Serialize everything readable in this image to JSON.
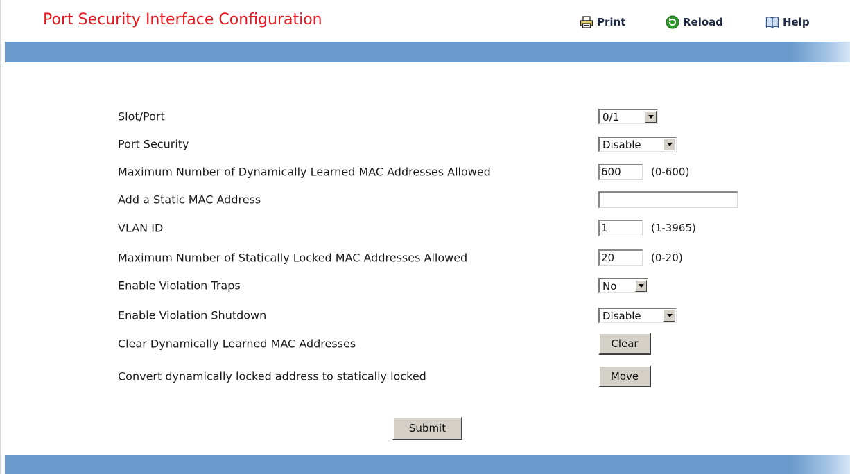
{
  "page": {
    "title": "Port Security Interface Configuration"
  },
  "toolbar": {
    "print": "Print",
    "reload": "Reload",
    "help": "Help"
  },
  "form": {
    "slot_port": {
      "label": "Slot/Port",
      "value": "0/1"
    },
    "port_security": {
      "label": "Port Security",
      "value": "Disable"
    },
    "max_dynamic": {
      "label": "Maximum Number of Dynamically Learned MAC Addresses Allowed",
      "value": "600",
      "range": "(0-600)"
    },
    "static_mac": {
      "label": "Add a Static MAC Address",
      "value": ""
    },
    "vlan_id": {
      "label": "VLAN ID",
      "value": "1",
      "range": "(1-3965)"
    },
    "max_static": {
      "label": "Maximum Number of Statically Locked MAC Addresses Allowed",
      "value": "20",
      "range": "(0-20)"
    },
    "violation_traps": {
      "label": "Enable Violation Traps",
      "value": "No"
    },
    "violation_shutdown": {
      "label": "Enable Violation Shutdown",
      "value": "Disable"
    },
    "clear_dynamic": {
      "label": "Clear Dynamically Learned MAC Addresses",
      "button": "Clear"
    },
    "convert_locked": {
      "label": "Convert dynamically locked address to statically locked",
      "button": "Move"
    }
  },
  "submit_label": "Submit",
  "colors": {
    "title": "#e8171f",
    "band": "#6a9acb",
    "button_face": "#d4d0c8"
  },
  "icons": {
    "print": "printer-icon",
    "reload": "reload-icon",
    "help": "book-icon"
  }
}
